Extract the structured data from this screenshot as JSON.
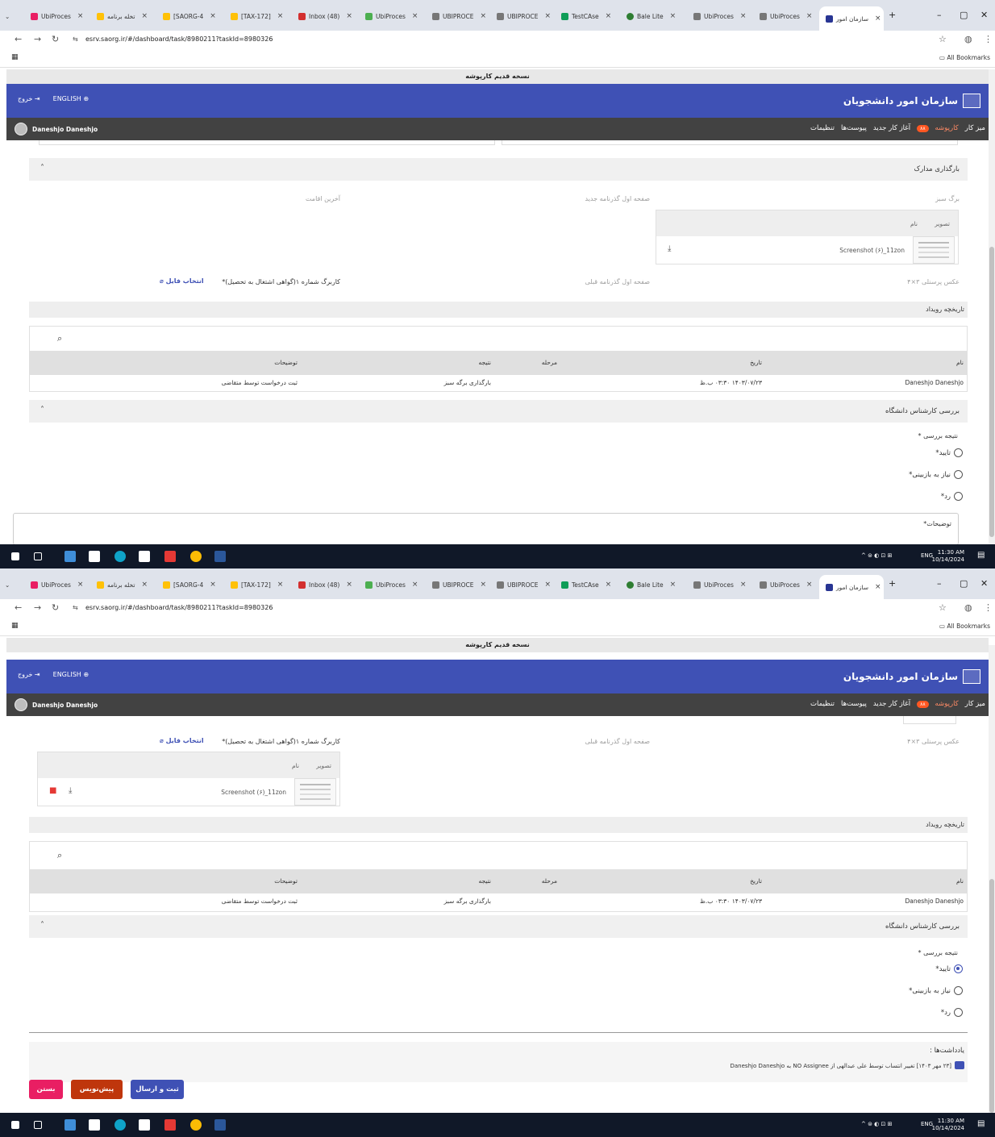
{
  "browser": {
    "tabs": [
      {
        "label": "UbiProces",
        "color": "#e91e63"
      },
      {
        "label": "تخله برنامه",
        "color": "#ffc107"
      },
      {
        "label": "[SAORG-4",
        "color": "#ffc107"
      },
      {
        "label": "[TAX-172]",
        "color": "#ffc107"
      },
      {
        "label": "Inbox (48)",
        "color": "#d32f2f"
      },
      {
        "label": "UbiProces",
        "color": "#4caf50"
      },
      {
        "label": "UBIPROCE",
        "color": "#555555"
      },
      {
        "label": "UBIPROCE",
        "color": "#555555"
      },
      {
        "label": "TestCAse",
        "color": "#0f9d58"
      },
      {
        "label": "Bale Lite",
        "color": "#2e7d32"
      },
      {
        "label": "UbiProces",
        "color": "#555555"
      },
      {
        "label": "UbiProces",
        "color": "#555555"
      }
    ],
    "active_tab": "سازمان امور",
    "url": "esrv.saorg.ir/#/dashboard/task/8980211?taskId=8980326",
    "all_bookmarks": "All Bookmarks",
    "new_tab": "+"
  },
  "app": {
    "old_version_banner": "نسخه قدیم کارپوشه",
    "brand": "سازمان امور دانشجویان",
    "english": "ENGLISH",
    "logout": "خروج",
    "user": "Daneshjo Daneshjo",
    "menu": [
      "میز کار",
      "کارپوشه",
      "آغاز کار جدید",
      "پیوست‌ها",
      "تنظیمات"
    ],
    "badge": "۸۸"
  },
  "shot1": {
    "docs_title": "بارگذاری مدارک",
    "green_sheet": "برگ سبز",
    "passport_new": "صفحه اول گذرنامه جدید",
    "last_residence": "آخرین اقامت",
    "col_image": "تصویر",
    "col_name": "نام",
    "file_name": "Screenshot (۶)_11zon",
    "photo": "عکس پرسنلی ۳×۴",
    "passport_old": "صفحه اول گذرنامه قبلی",
    "kargreg": "کاربرگ شماره ۱(گواهی اشتغال به تحصیل)*",
    "choose_file": "انتخاب فایل"
  },
  "history": {
    "title": "تاریخچه رویداد",
    "headers": {
      "name": "نام",
      "date": "تاریخ",
      "stage": "مرحله",
      "result": "نتیجه",
      "desc": "توضیحات"
    },
    "row": {
      "name": "Daneshjo Daneshjo",
      "date": "۱۴۰۳/۰۷/۲۳ ۰۳:۳۰ ب.ظ",
      "stage": "",
      "result": "بارگذاری برگه سبز",
      "desc": "ثبت درخواست توسط متقاضی"
    }
  },
  "review": {
    "title": "بررسی کارشناس دانشگاه",
    "question": "نتیجه بررسی *",
    "options": [
      "تایید*",
      "نیاز به بازبینی*",
      "رد*"
    ],
    "desc_label": "توضیحات*"
  },
  "notes": {
    "title": "یادداشت‌ها :",
    "text": "[۲۳ مهر ۱۴۰۳] تغییر انتساب توسط علی عبدالهی از NO Assignee به Daneshjo Daneshjo"
  },
  "actions": {
    "submit": "ثبت و ارسال",
    "draft": "پیش‌نویس",
    "close": "بستن"
  },
  "taskbar": {
    "time": "11:30 AM",
    "date": "10/14/2024",
    "lang": "ENG"
  }
}
